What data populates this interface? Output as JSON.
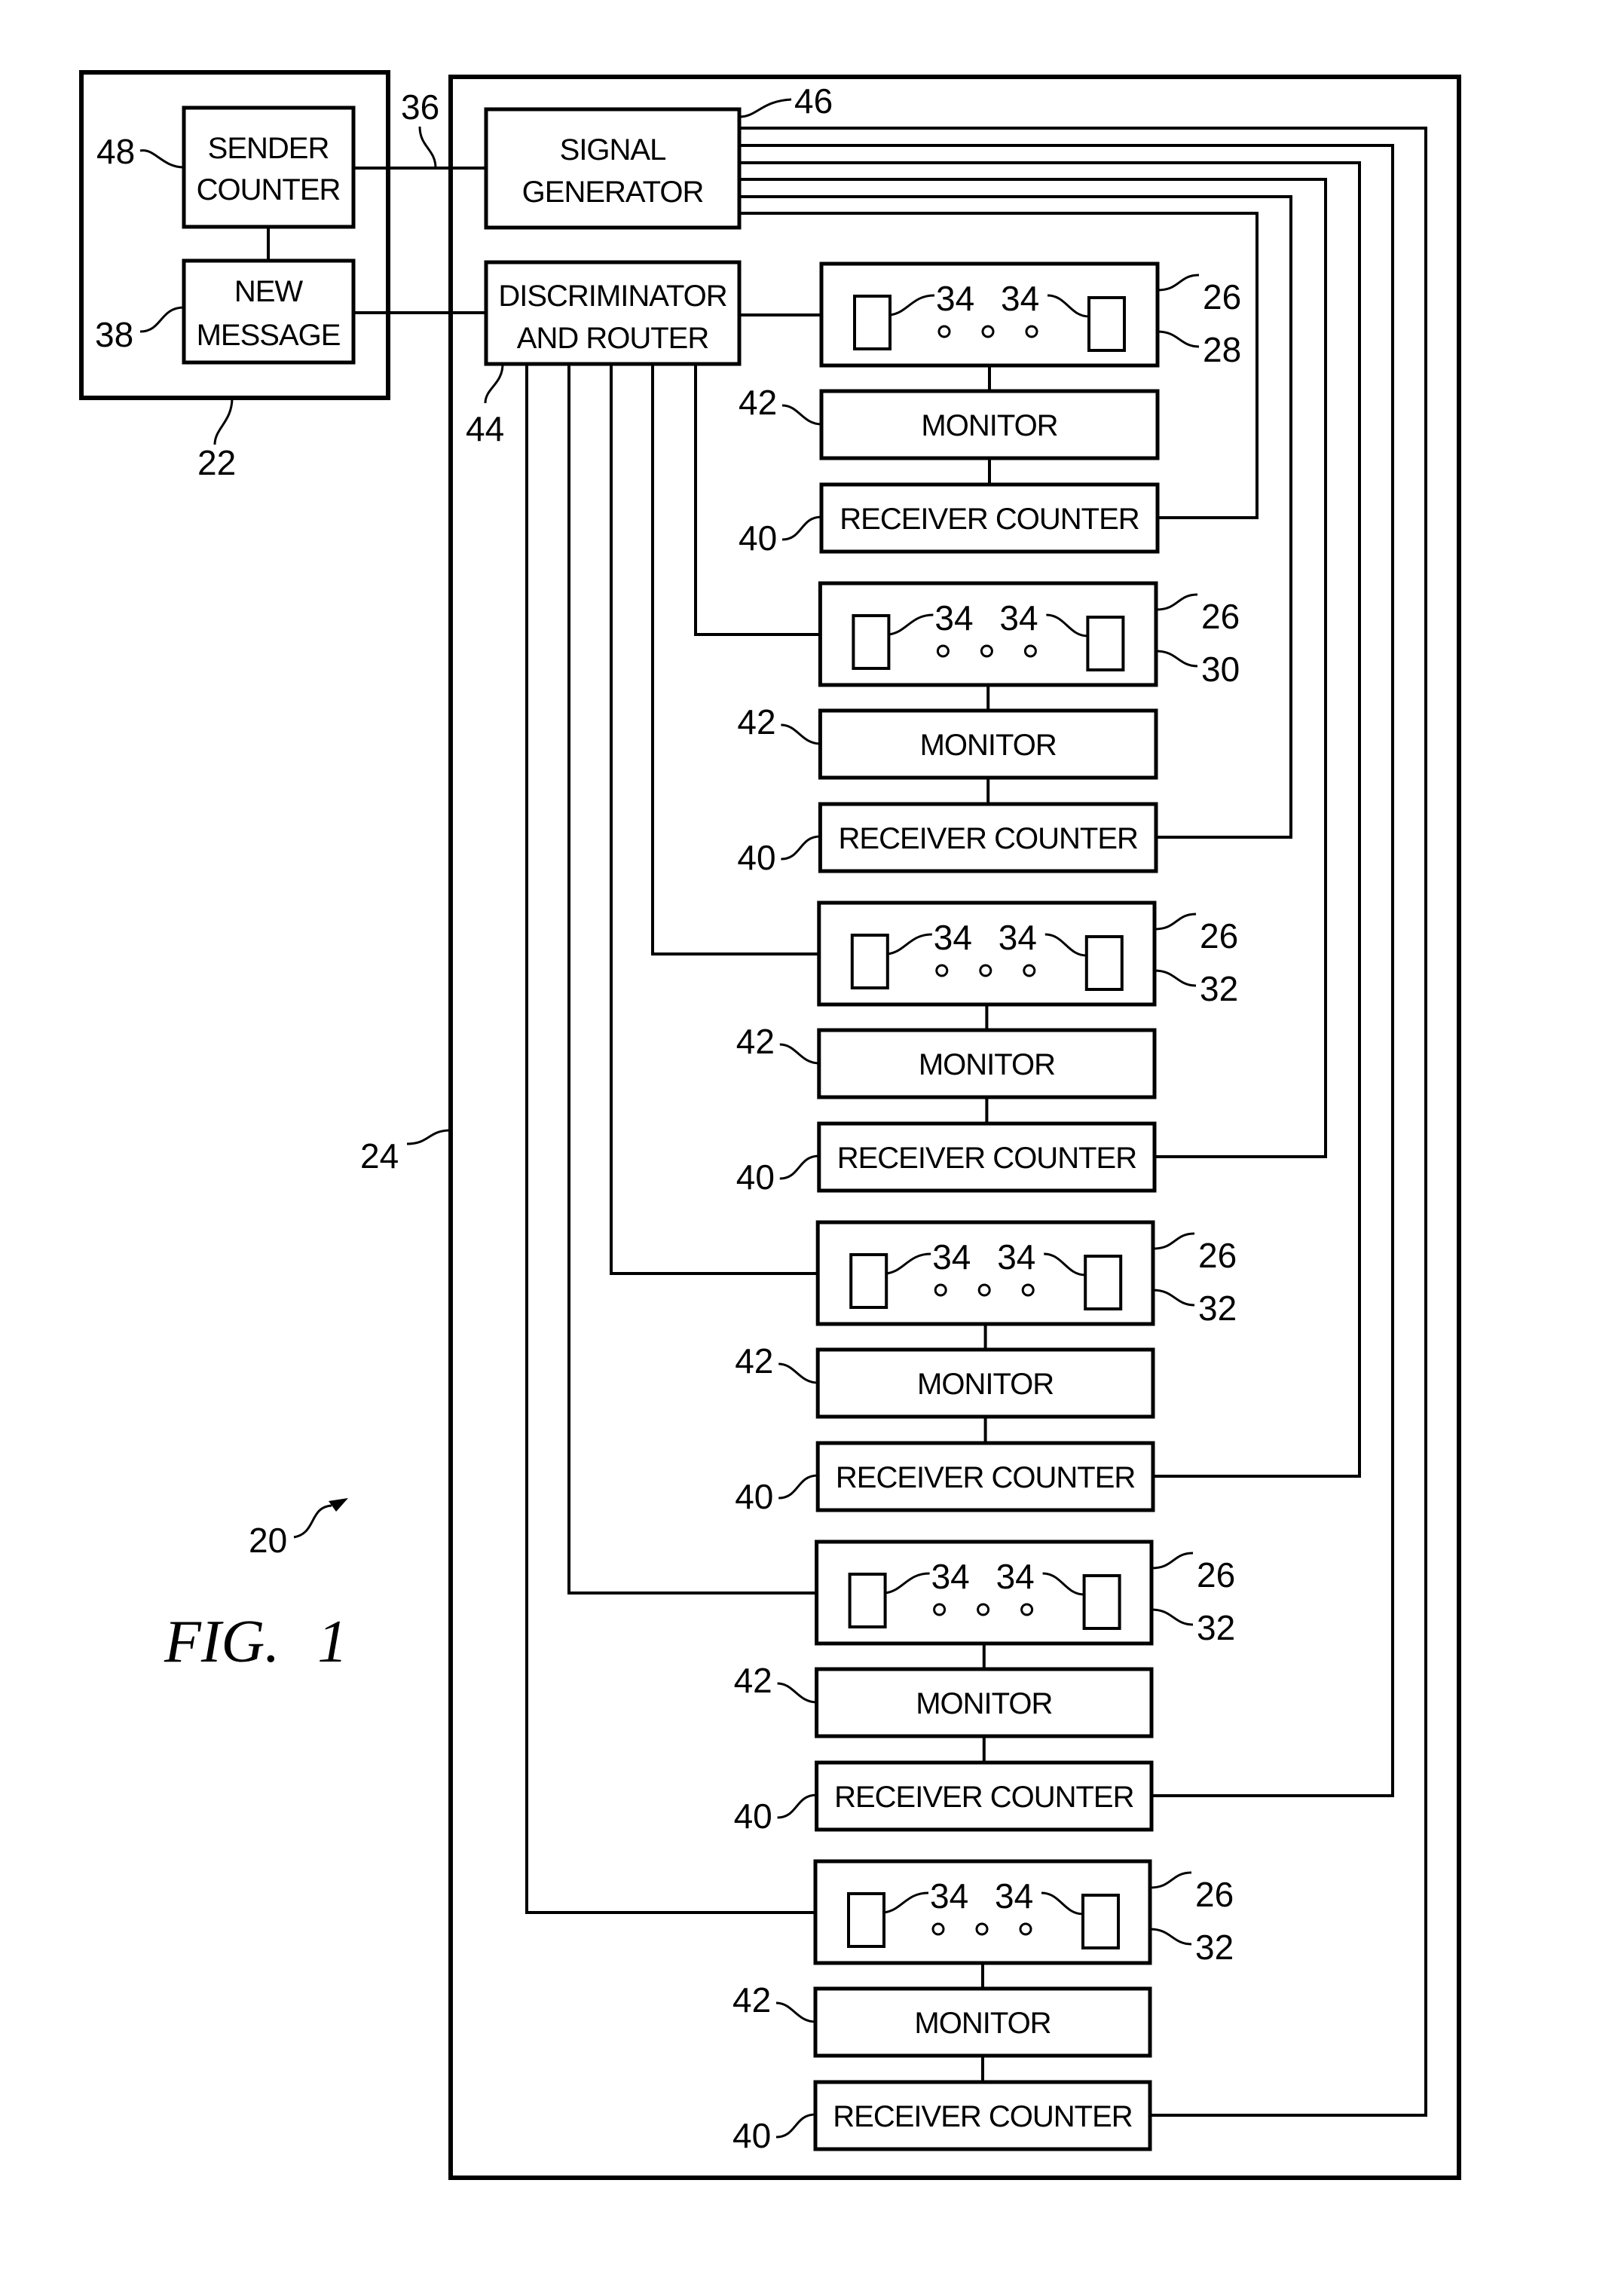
{
  "figure": {
    "title": "FIG.",
    "number": "1",
    "system_ref": "20"
  },
  "sender": {
    "ref": "22",
    "sender_counter": {
      "ref": "48",
      "lines": [
        "SENDER",
        "COUNTER"
      ]
    },
    "new_message": {
      "ref": "38",
      "lines": [
        "NEW",
        "MESSAGE"
      ]
    }
  },
  "link_ref": "36",
  "receiver_system": {
    "ref": "24",
    "signal_generator": {
      "ref": "46",
      "lines": [
        "SIGNAL",
        "GENERATOR"
      ]
    },
    "discriminator": {
      "ref": "44",
      "lines": [
        "DISCRIMINATOR",
        "AND ROUTER"
      ]
    },
    "modules": [
      {
        "ref_top": "26",
        "ref_bottom": "28",
        "component_ref_left": "34",
        "component_ref_right": "34",
        "monitor": "MONITOR",
        "monitor_ref": "42",
        "counter": "RECEIVER  COUNTER",
        "counter_ref": "40"
      },
      {
        "ref_top": "26",
        "ref_bottom": "30",
        "component_ref_left": "34",
        "component_ref_right": "34",
        "monitor": "MONITOR",
        "monitor_ref": "42",
        "counter": "RECEIVER  COUNTER",
        "counter_ref": "40"
      },
      {
        "ref_top": "26",
        "ref_bottom": "32",
        "component_ref_left": "34",
        "component_ref_right": "34",
        "monitor": "MONITOR",
        "monitor_ref": "42",
        "counter": "RECEIVER  COUNTER",
        "counter_ref": "40"
      },
      {
        "ref_top": "26",
        "ref_bottom": "32",
        "component_ref_left": "34",
        "component_ref_right": "34",
        "monitor": "MONITOR",
        "monitor_ref": "42",
        "counter": "RECEIVER  COUNTER",
        "counter_ref": "40"
      },
      {
        "ref_top": "26",
        "ref_bottom": "32",
        "component_ref_left": "34",
        "component_ref_right": "34",
        "monitor": "MONITOR",
        "monitor_ref": "42",
        "counter": "RECEIVER  COUNTER",
        "counter_ref": "40"
      },
      {
        "ref_top": "26",
        "ref_bottom": "32",
        "component_ref_left": "34",
        "component_ref_right": "34",
        "monitor": "MONITOR",
        "monitor_ref": "42",
        "counter": "RECEIVER  COUNTER",
        "counter_ref": "40"
      }
    ]
  },
  "colors": {
    "ink": "#000000",
    "paper": "#ffffff"
  }
}
